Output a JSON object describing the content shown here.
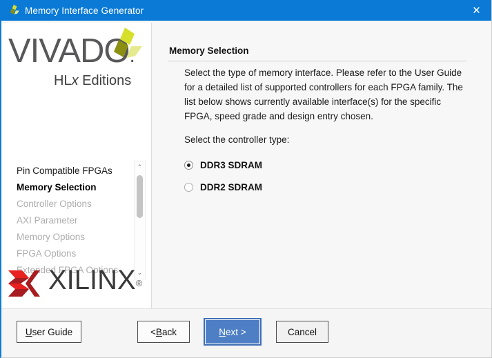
{
  "window": {
    "title": "Memory Interface Generator",
    "title_icon": "vivado-tri-lobe-icon",
    "close_icon": "✕",
    "accent_color": "#0a7ad6"
  },
  "sidebar": {
    "product_logo": {
      "wordmark": "VIVADO",
      "dot": ".",
      "subtitle_prefix": "HL",
      "subtitle_italic": "x",
      "subtitle_suffix": " Editions"
    },
    "nav_items": [
      {
        "label": "Pin Compatible FPGAs",
        "state": "enabled"
      },
      {
        "label": "Memory Selection",
        "state": "active"
      },
      {
        "label": "Controller Options",
        "state": "disabled"
      },
      {
        "label": "AXI Parameter",
        "state": "disabled"
      },
      {
        "label": "Memory Options",
        "state": "disabled"
      },
      {
        "label": "FPGA Options",
        "state": "disabled"
      },
      {
        "label": "Extended FPGA Options",
        "state": "disabled"
      }
    ],
    "scrollbar": {
      "up_arrow": "⌃",
      "down_arrow": "⌄"
    },
    "vendor_logo": {
      "wordmark": "XILINX",
      "registered": "®",
      "mark_colors": [
        "#e8201f",
        "#a61c21"
      ]
    }
  },
  "main": {
    "section_title": "Memory Selection",
    "description": "Select the type of memory interface. Please refer to the User Guide for a detailed list of supported controllers for each FPGA family. The list below shows currently available interface(s) for the specific FPGA, speed grade and design entry chosen.",
    "controller_label": "Select the controller type:",
    "controller_options": [
      {
        "label": "DDR3 SDRAM",
        "selected": true
      },
      {
        "label": "DDR2 SDRAM",
        "selected": false
      }
    ]
  },
  "footer": {
    "user_guide": {
      "mnemonic": "U",
      "rest": "ser Guide"
    },
    "back": {
      "prefix": "< ",
      "mnemonic": "B",
      "rest": "ack"
    },
    "next": {
      "mnemonic": "N",
      "rest": "ext >",
      "primary_color": "#4e7fc4"
    },
    "cancel": {
      "label": "Cancel"
    }
  }
}
